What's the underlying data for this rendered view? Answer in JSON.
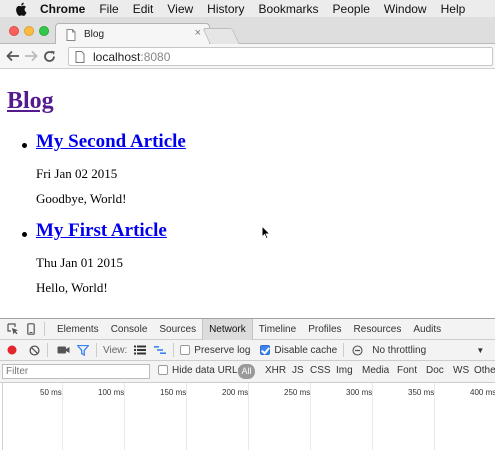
{
  "menubar": {
    "app": "Chrome",
    "items": [
      "File",
      "Edit",
      "View",
      "History",
      "Bookmarks",
      "People",
      "Window",
      "Help"
    ]
  },
  "tab": {
    "title": "Blog",
    "close": "×"
  },
  "address": {
    "host": "localhost",
    "port": ":8080"
  },
  "page": {
    "title": "Blog",
    "articles": [
      {
        "title": "My Second Article",
        "date": "Fri Jan 02 2015",
        "body": "Goodbye, World!"
      },
      {
        "title": "My First Article",
        "date": "Thu Jan 01 2015",
        "body": "Hello, World!"
      }
    ]
  },
  "devtools": {
    "tabs": [
      "Elements",
      "Console",
      "Sources",
      "Network",
      "Timeline",
      "Profiles",
      "Resources",
      "Audits"
    ],
    "active_tab": "Network",
    "controls": {
      "view_label": "View:",
      "preserve_log": "Preserve log",
      "preserve_log_checked": false,
      "disable_cache": "Disable cache",
      "disable_cache_checked": true,
      "throttling": "No throttling"
    },
    "filter": {
      "placeholder": "Filter",
      "hide_data_urls": "Hide data URLs",
      "types": [
        "All",
        "XHR",
        "JS",
        "CSS",
        "Img",
        "Media",
        "Font",
        "Doc",
        "WS",
        "Other"
      ]
    },
    "timeline_ticks": [
      "50 ms",
      "100 ms",
      "150 ms",
      "200 ms",
      "250 ms",
      "300 ms",
      "350 ms",
      "400 ms"
    ]
  },
  "colors": {
    "visited_link": "#551a8b",
    "link": "#0000ee",
    "record_red": "#e2262b",
    "checkbox_blue": "#3b84f0",
    "filter_blue": "#3b84f0"
  }
}
